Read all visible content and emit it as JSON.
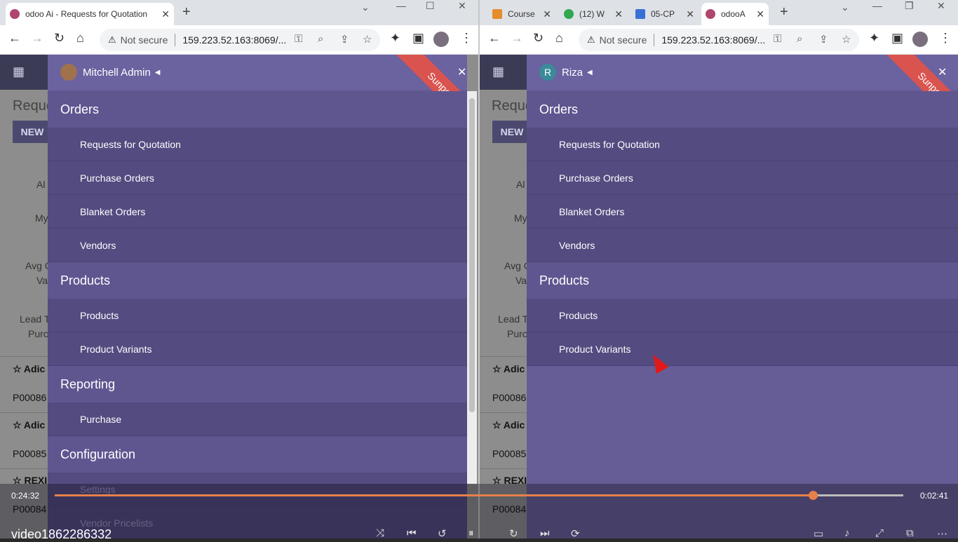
{
  "left_window": {
    "tabs": [
      {
        "title": "odoo Ai - Requests for Quotation",
        "favicon_color": "#b0456f",
        "active": true
      }
    ],
    "address": {
      "security": "Not secure",
      "url": "159.223.52.163:8069/..."
    },
    "app_bg": {
      "page_title": "Reque",
      "new_button": "NEW",
      "stats": [
        "Al",
        "My",
        "Avg C",
        "Va",
        "Lead T",
        "Purc"
      ],
      "rows": [
        {
          "name": "Adic",
          "ref": "P00086"
        },
        {
          "name": "Adic",
          "ref": "P00085"
        },
        {
          "name": "REXI",
          "ref": "P00084"
        }
      ]
    },
    "drawer": {
      "user": "Mitchell Admin",
      "ribbon": "Sunpop.cn",
      "sections": [
        {
          "title": "Orders",
          "items": [
            "Requests for Quotation",
            "Purchase Orders",
            "Blanket Orders",
            "Vendors"
          ]
        },
        {
          "title": "Products",
          "items": [
            "Products",
            "Product Variants"
          ]
        },
        {
          "title": "Reporting",
          "items": [
            "Purchase"
          ]
        },
        {
          "title": "Configuration",
          "items": [
            "Settings",
            "Vendor Pricelists"
          ]
        }
      ]
    }
  },
  "right_window": {
    "tabs": [
      {
        "title": "Course",
        "favicon_color": "#e58c2b"
      },
      {
        "title": "(12) W",
        "favicon_color": "#2fa84f"
      },
      {
        "title": "05-CP",
        "favicon_color": "#3b6fd6"
      },
      {
        "title": "odooA",
        "favicon_color": "#b0456f",
        "active": true
      }
    ],
    "address": {
      "security": "Not secure",
      "url": "159.223.52.163:8069/..."
    },
    "app_bg": {
      "page_title": "Reque",
      "new_button": "NEW",
      "stats": [
        "Al",
        "My",
        "Avg C",
        "Va",
        "Lead T",
        "Purc"
      ],
      "rows": [
        {
          "name": "Adic",
          "ref": "P00086"
        },
        {
          "name": "Adic",
          "ref": "P00085"
        },
        {
          "name": "REXI",
          "ref": "P00084"
        }
      ]
    },
    "drawer": {
      "user": "Riza",
      "user_initial": "R",
      "ribbon": "Sunpop.cn",
      "sections": [
        {
          "title": "Orders",
          "items": [
            "Requests for Quotation",
            "Purchase Orders",
            "Blanket Orders",
            "Vendors"
          ]
        },
        {
          "title": "Products",
          "items": [
            "Products",
            "Product Variants"
          ]
        }
      ]
    }
  },
  "video": {
    "elapsed": "0:24:32",
    "total": "0:02:41",
    "progress": 0.893,
    "title": "video1862286332"
  },
  "colors": {
    "accent": "#675d96",
    "progress": "#e8804a",
    "ribbon": "#d9534f"
  }
}
